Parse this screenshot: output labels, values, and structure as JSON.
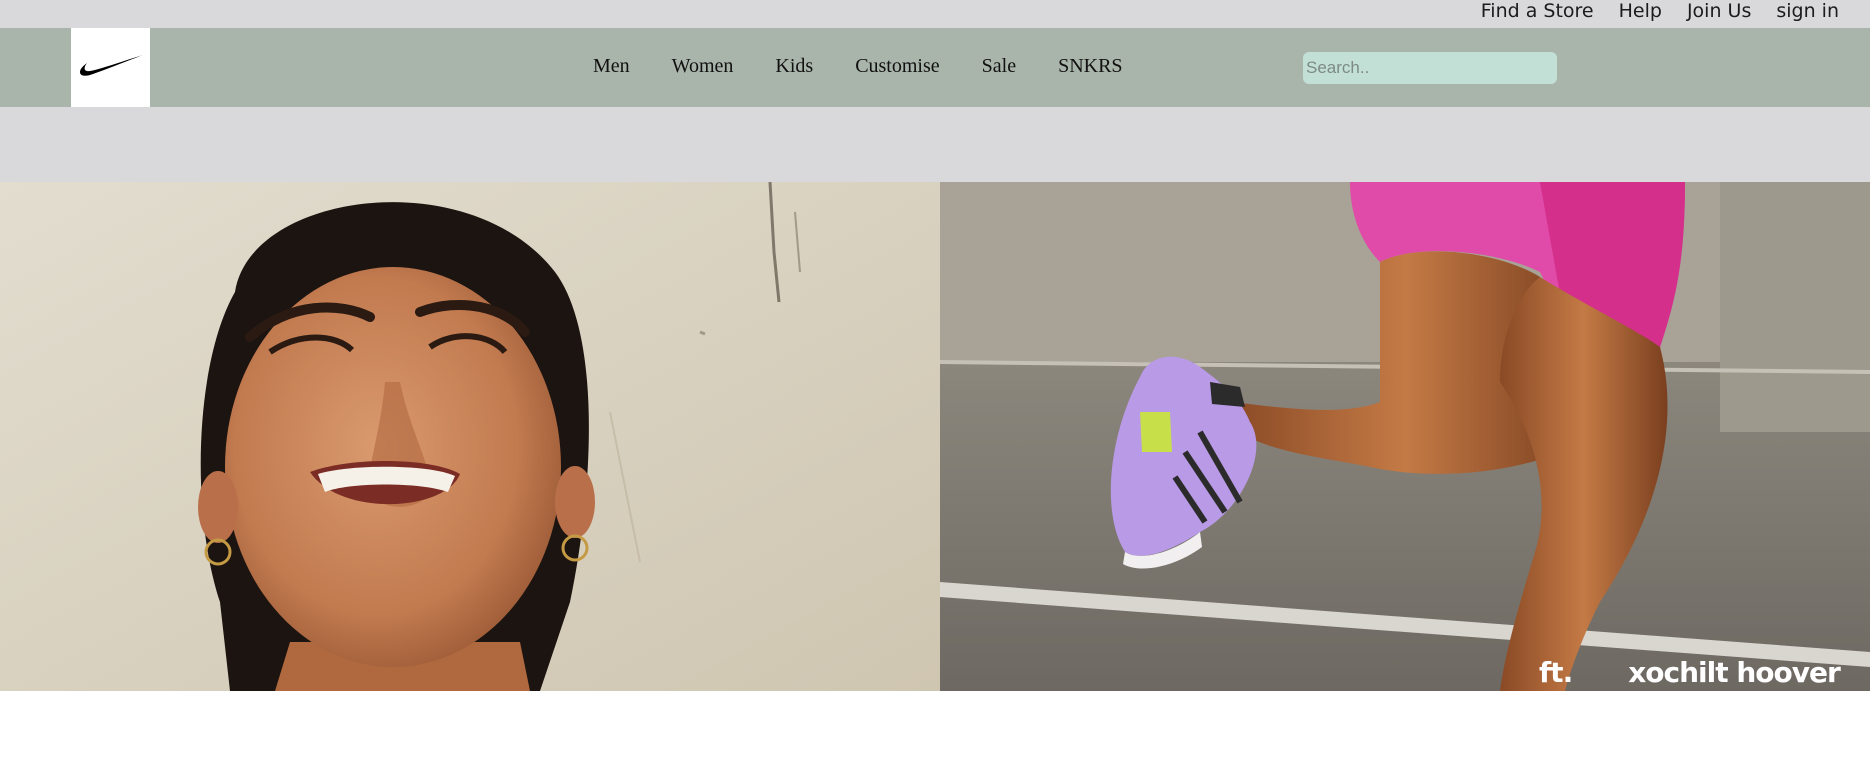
{
  "utility_nav": {
    "items": [
      "Find a Store",
      "Help",
      "Join Us",
      "sign in"
    ]
  },
  "header": {
    "logo_icon": "swoosh-icon",
    "nav": [
      "Men",
      "Women",
      "Kids",
      "Customise",
      "Sale",
      "SNKRS"
    ],
    "search": {
      "placeholder": "Search..",
      "value": ""
    }
  },
  "hero": {
    "credit_prefix": "ft.",
    "credit_name": "xochilt hoover"
  },
  "colors": {
    "utility_bar_bg": "#d9d9db",
    "nav_bg": "#a9b4aa",
    "search_bg": "#c3e0d6",
    "logo_bg": "#ffffff"
  }
}
